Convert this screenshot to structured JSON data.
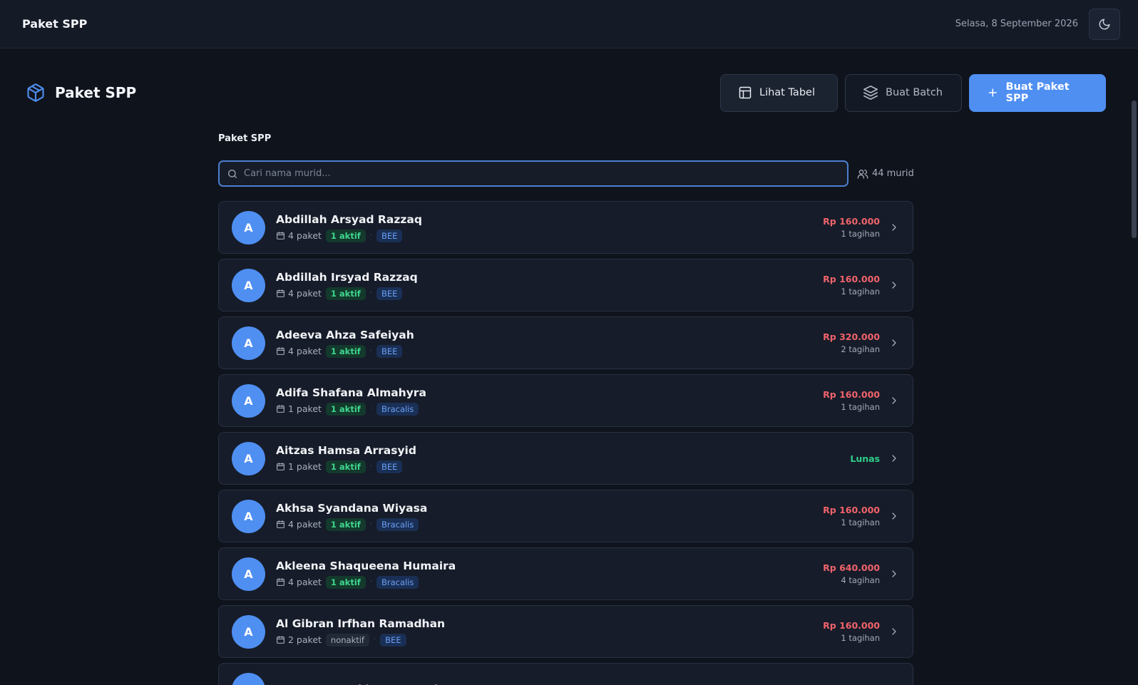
{
  "topbar": {
    "title": "Paket SPP",
    "date": "Selasa, 8 September 2026",
    "theme_icon": "moon-icon"
  },
  "header": {
    "title": "Paket SPP",
    "icon": "package-icon",
    "buttons": {
      "table": "Lihat Tabel",
      "batch": "Buat Batch",
      "create": "Buat Paket SPP"
    }
  },
  "section": {
    "label": "Paket SPP",
    "search_placeholder": "Cari nama murid...",
    "search_value": "",
    "count": "44 murid"
  },
  "colors": {
    "accent": "#4f8ff2",
    "due": "#f0636b",
    "paid": "#2fcf8a"
  },
  "students": [
    {
      "initial": "A",
      "name": "Abdillah Arsyad Razzaq",
      "packages": "4 paket",
      "status": "1 aktif",
      "status_type": "active",
      "program": "BEE",
      "amount": "Rp 160.000",
      "bills": "1 tagihan",
      "paid": false
    },
    {
      "initial": "A",
      "name": "Abdillah Irsyad Razzaq",
      "packages": "4 paket",
      "status": "1 aktif",
      "status_type": "active",
      "program": "BEE",
      "amount": "Rp 160.000",
      "bills": "1 tagihan",
      "paid": false
    },
    {
      "initial": "A",
      "name": "Adeeva Ahza Safeiyah",
      "packages": "4 paket",
      "status": "1 aktif",
      "status_type": "active",
      "program": "BEE",
      "amount": "Rp 320.000",
      "bills": "2 tagihan",
      "paid": false
    },
    {
      "initial": "A",
      "name": "Adifa Shafana Almahyra",
      "packages": "1 paket",
      "status": "1 aktif",
      "status_type": "active",
      "program": "Bracalis",
      "amount": "Rp 160.000",
      "bills": "1 tagihan",
      "paid": false
    },
    {
      "initial": "A",
      "name": "Aitzas Hamsa Arrasyid",
      "packages": "1 paket",
      "status": "1 aktif",
      "status_type": "active",
      "program": "BEE",
      "amount": "",
      "bills": "",
      "paid": true,
      "paid_label": "Lunas"
    },
    {
      "initial": "A",
      "name": "Akhsa Syandana Wiyasa",
      "packages": "4 paket",
      "status": "1 aktif",
      "status_type": "active",
      "program": "Bracalis",
      "amount": "Rp 160.000",
      "bills": "1 tagihan",
      "paid": false
    },
    {
      "initial": "A",
      "name": "Akleena Shaqueena Humaira",
      "packages": "4 paket",
      "status": "1 aktif",
      "status_type": "active",
      "program": "Bracalis",
      "amount": "Rp 640.000",
      "bills": "4 tagihan",
      "paid": false
    },
    {
      "initial": "A",
      "name": "Al Gibran Irfhan Ramadhan",
      "packages": "2 paket",
      "status": "nonaktif",
      "status_type": "inactive",
      "program": "BEE",
      "amount": "Rp 160.000",
      "bills": "1 tagihan",
      "paid": false
    },
    {
      "initial": "A",
      "name": "Aryasatya Sakha Manggala",
      "packages": "",
      "status": "",
      "status_type": "",
      "program": "",
      "amount": "",
      "bills": "",
      "paid": false
    }
  ]
}
